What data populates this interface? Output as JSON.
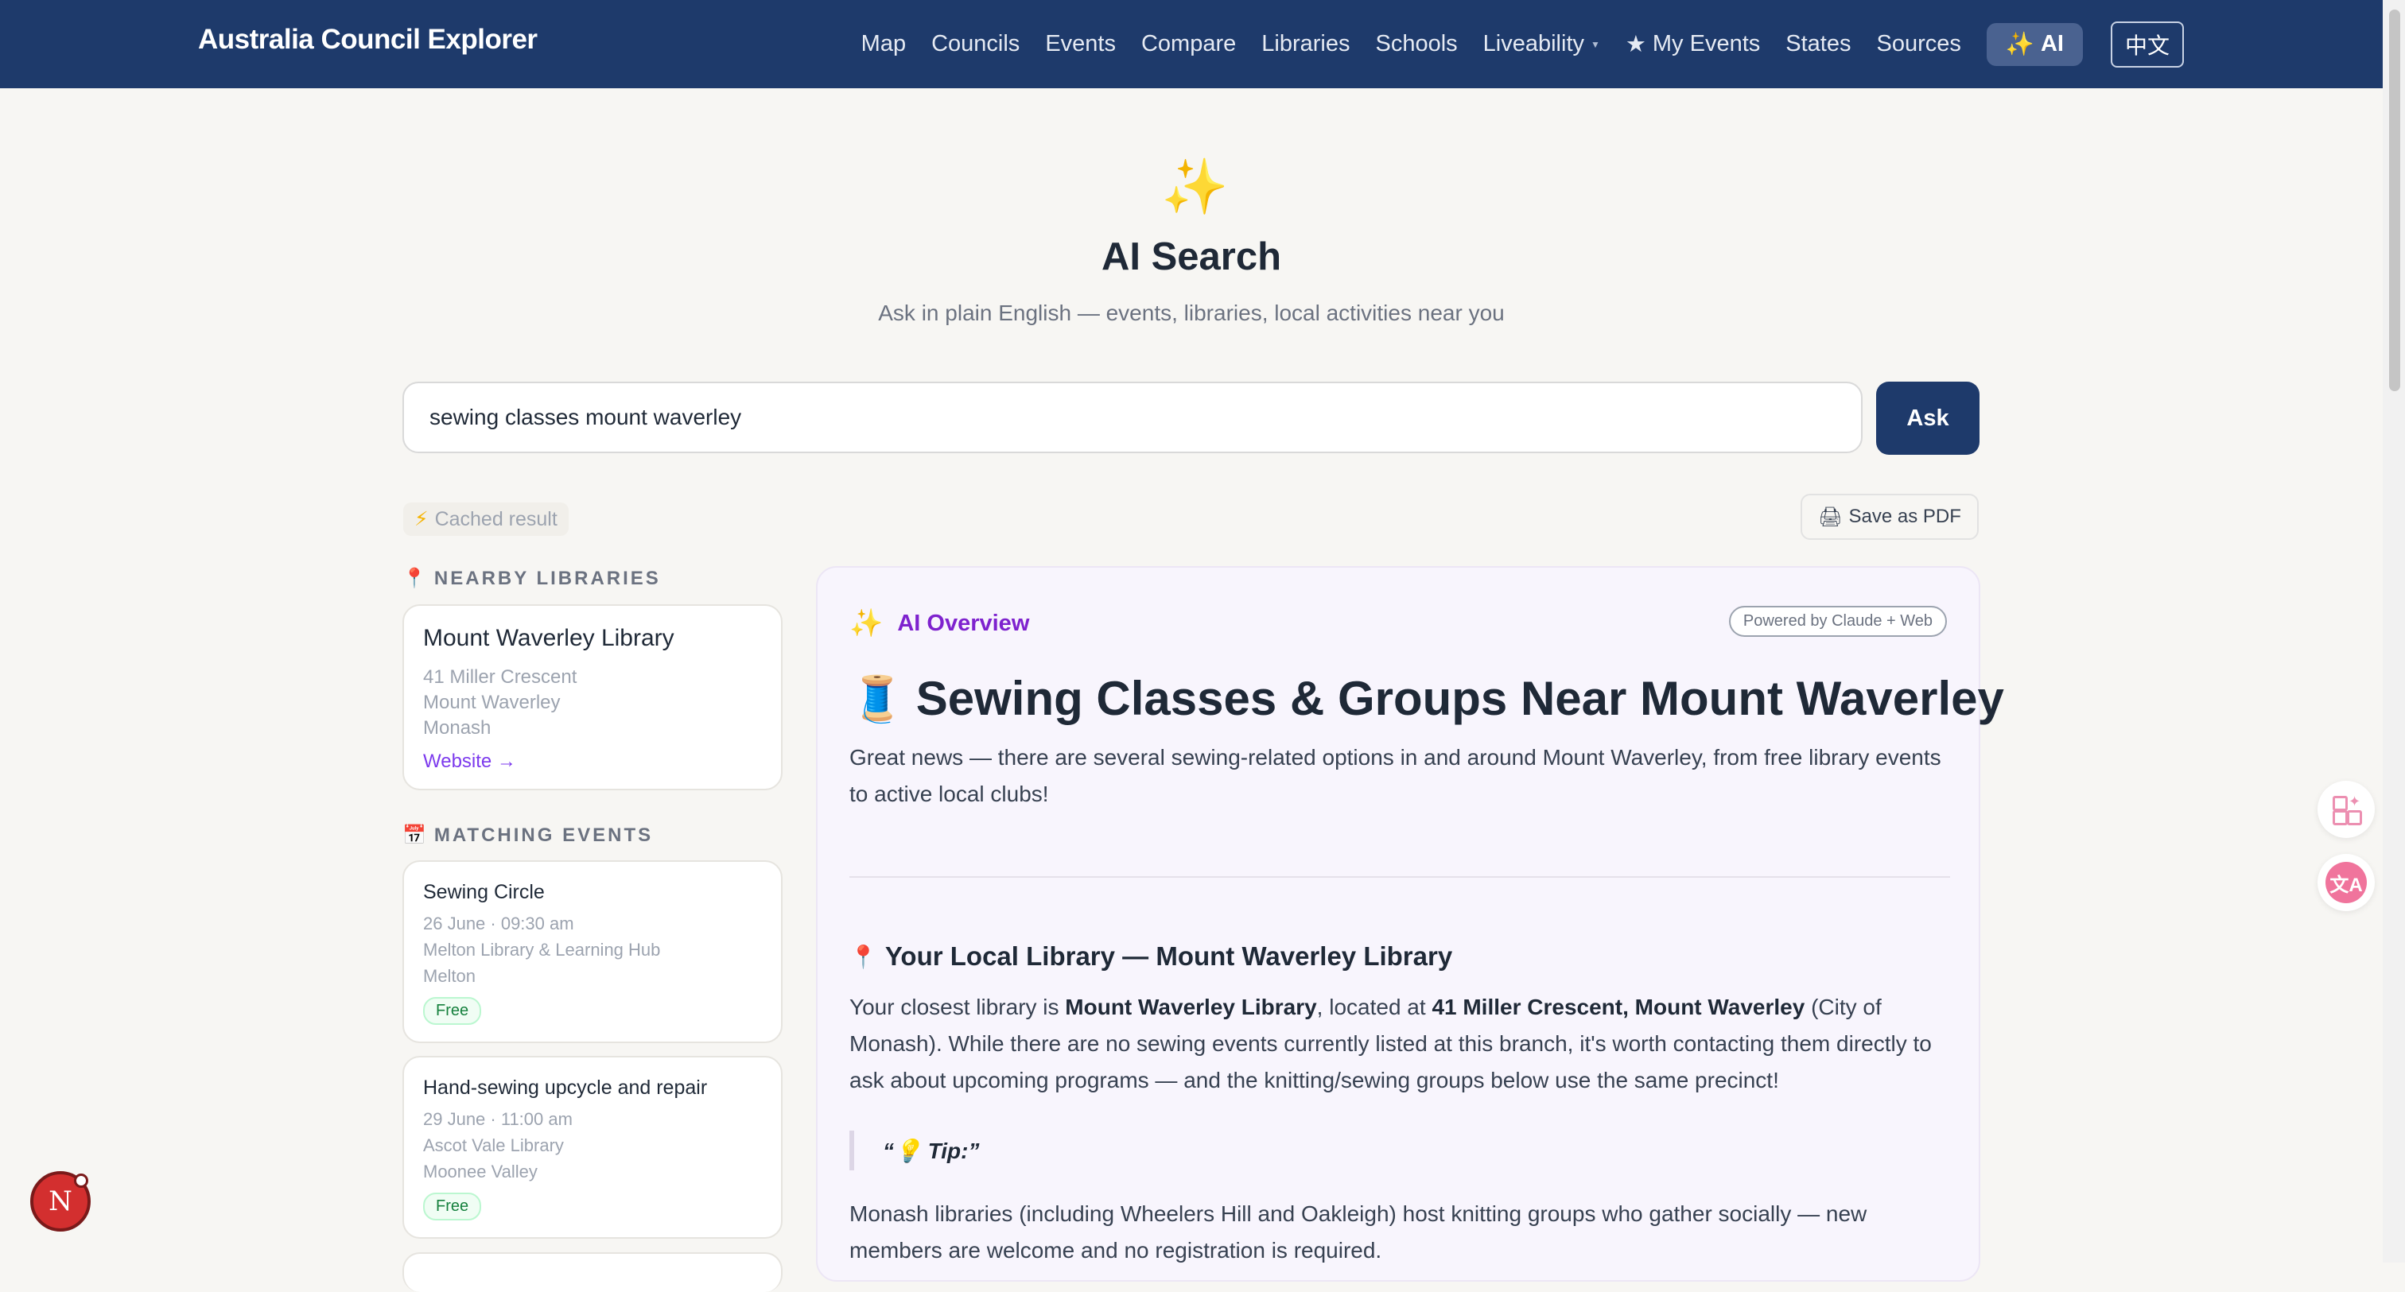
{
  "header": {
    "brand": "Australia Council Explorer",
    "nav": [
      {
        "label": "Map"
      },
      {
        "label": "Councils"
      },
      {
        "label": "Events"
      },
      {
        "label": "Compare"
      },
      {
        "label": "Libraries"
      },
      {
        "label": "Schools"
      },
      {
        "label": "Liveability"
      },
      {
        "label": "My Events"
      },
      {
        "label": "States"
      },
      {
        "label": "Sources"
      },
      {
        "label": "AI"
      },
      {
        "label": "中文"
      }
    ]
  },
  "hero": {
    "title": "AI Search",
    "subtitle": "Ask in plain English — events, libraries, local activities near you"
  },
  "search": {
    "value": "sewing classes mount waverley",
    "button": "Ask"
  },
  "status": {
    "cached": "Cached result",
    "save_pdf": "Save as PDF"
  },
  "nearby": {
    "label": "NEARBY LIBRARIES",
    "library": {
      "name": "Mount Waverley Library",
      "address": "41 Miller Crescent",
      "suburb": "Mount Waverley",
      "council": "Monash",
      "link": "Website →"
    }
  },
  "events": {
    "label": "MATCHING EVENTS",
    "items": [
      {
        "name": "Sewing Circle",
        "datetime": "26 June · 09:30 am",
        "venue": "Melton Library & Learning Hub",
        "council": "Melton",
        "badge": "Free"
      },
      {
        "name": "Hand-sewing upcycle and repair",
        "datetime": "29 June · 11:00 am",
        "venue": "Ascot Vale Library",
        "council": "Moonee Valley",
        "badge": "Free"
      }
    ]
  },
  "overview": {
    "label": "AI Overview",
    "powered": "Powered by Claude + Web",
    "title": "Sewing Classes & Groups Near Mount Waverley",
    "intro": "Great news — there are several sewing-related options in and around Mount Waverley, from free library events to active local clubs!",
    "section_title": "Your Local Library — Mount Waverley Library",
    "p1_a": "Your closest library is ",
    "p1_b": "Mount Waverley Library",
    "p1_c": ", located at ",
    "p1_d": "41 Miller Crescent, Mount Waverley",
    "p1_e": " (City of Monash). While there are no sewing events currently listed at this branch, it's worth contacting them directly to ask about upcoming programs — and the knitting/sewing groups below use the same precinct!",
    "tip": "“💡 Tip:”",
    "p2": "Monash libraries (including Wheelers Hill and Oakleigh) host knitting groups who gather socially — new members are welcome and no registration is required."
  },
  "avatar": {
    "initial": "N"
  }
}
